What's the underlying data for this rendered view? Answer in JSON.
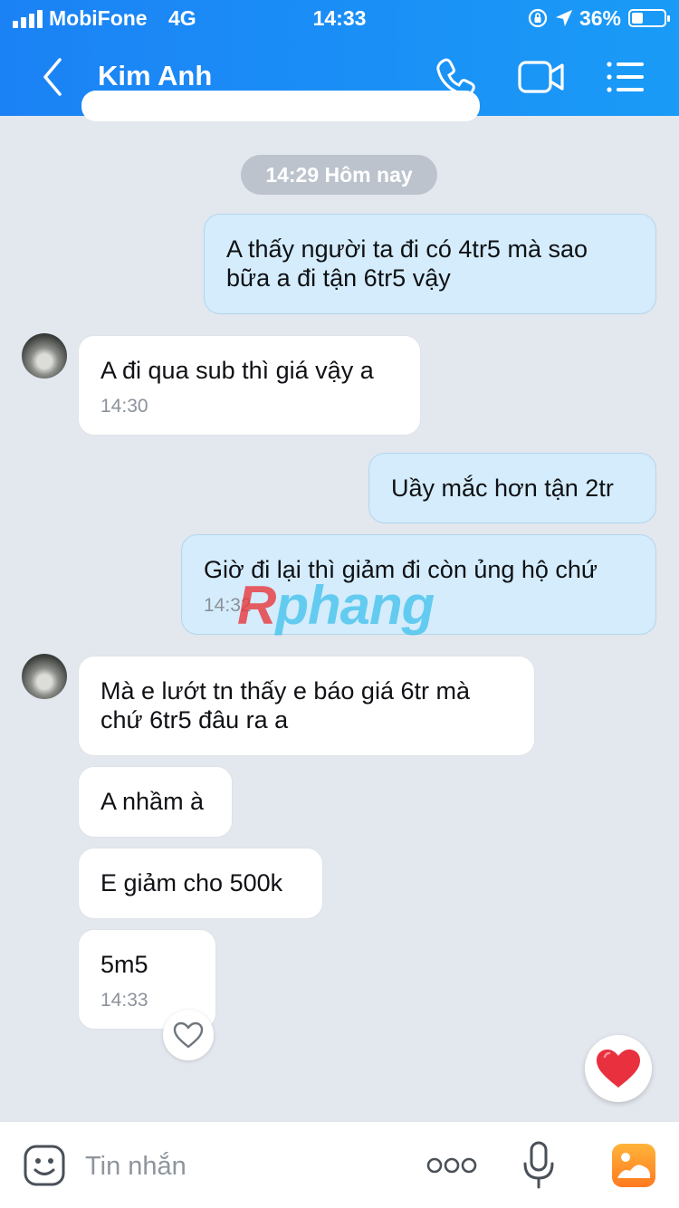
{
  "status_bar": {
    "carrier": "MobiFone",
    "network": "4G",
    "time": "14:33",
    "battery": "36%",
    "battery_level": 0.36
  },
  "header": {
    "contact_name": "Kim Anh",
    "icons": [
      "back-icon",
      "phone-icon",
      "video-call-icon",
      "menu-icon"
    ]
  },
  "chat": {
    "date_label": "14:29 Hôm nay",
    "messages": [
      {
        "side": "out",
        "text": "A thấy người ta đi có 4tr5 mà sao bữa a đi tận 6tr5 vậy"
      },
      {
        "side": "in",
        "text": "A đi qua sub thì giá vậy a",
        "time": "14:30"
      },
      {
        "side": "out",
        "text": "Uầy mắc hơn tận 2tr"
      },
      {
        "side": "out",
        "text": "Giờ đi lại thì giảm đi còn ủng hộ chứ",
        "time": "14:32"
      },
      {
        "side": "in",
        "text": "Mà e lướt tn thấy e báo giá 6tr mà chứ 6tr5 đâu ra a"
      },
      {
        "side": "in",
        "text": "A nhầm à"
      },
      {
        "side": "in",
        "text": "E giảm cho 500k"
      },
      {
        "side": "in",
        "text": "5m5",
        "time": "14:33"
      }
    ],
    "watermark": {
      "first": "R",
      "rest": "phang"
    }
  },
  "input_bar": {
    "placeholder": "Tin nhắn",
    "icons": [
      "emoji-icon",
      "more-icon",
      "microphone-icon",
      "image-icon"
    ]
  },
  "colors": {
    "header": "#1b8ef6",
    "outgoing_bubble": "#d4ecfb",
    "incoming_bubble": "#ffffff",
    "chat_background": "#e3e7ee",
    "heart": "#e8303f"
  }
}
